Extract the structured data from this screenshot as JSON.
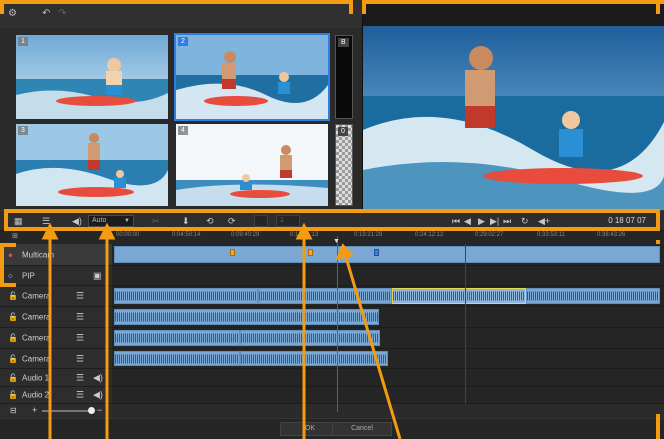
{
  "toolbar": {
    "icons": [
      "gear-icon",
      "undo-icon",
      "redo-icon"
    ]
  },
  "cameras": [
    {
      "number": "1"
    },
    {
      "number": "2",
      "active": true
    },
    {
      "number": "3"
    },
    {
      "number": "4"
    },
    {
      "number": "B"
    },
    {
      "number": "0"
    }
  ],
  "controls": {
    "audio_select": "Auto",
    "spin_value": "1",
    "timecode": "0 18 07 07"
  },
  "ruler": {
    "labels": [
      "00:00:00",
      "0:04:50:14",
      "0:09:40:29",
      "0:14:31:13",
      "0:19:21:28",
      "0:24:12:12",
      "0:29:02:27",
      "0:33:53:11",
      "0:38:43:26"
    ]
  },
  "tracks": [
    {
      "name": "Multicam"
    },
    {
      "name": "PIP"
    },
    {
      "name": "Camera"
    },
    {
      "name": "Camera"
    },
    {
      "name": "Camera"
    },
    {
      "name": "Camera"
    },
    {
      "name": "Audio 1"
    },
    {
      "name": "Audio 2"
    }
  ],
  "zoom": {
    "minus": "+",
    "plus": "−"
  },
  "footer": {
    "ok": "OK",
    "cancel": "Cancel"
  },
  "colors": {
    "accent": "#2f7de1",
    "callout": "#f39c12",
    "clip": "#7aa8d2",
    "playhead": "#c0392b"
  }
}
